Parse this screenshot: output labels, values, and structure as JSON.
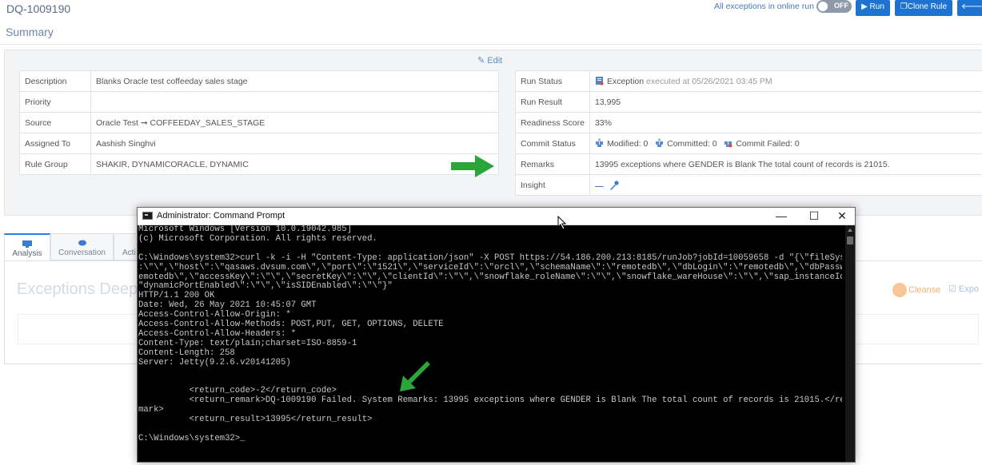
{
  "header": {
    "rule_id": "DQ-1009190",
    "exceptions_online_label": "All exceptions in online run",
    "toggle_label": "OFF",
    "run_label": "▶ Run",
    "clone_label": "❐Clone Rule",
    "ge_label": "🡐 Ge"
  },
  "summary": {
    "title": "Summary",
    "edit_label": "✎ Edit",
    "left_rows": [
      {
        "key": "Description",
        "value": "Blanks Oracle test coffeeday sales stage"
      },
      {
        "key": "Priority",
        "value": ""
      },
      {
        "key": "Source",
        "value": "Oracle Test ➞ COFFEEDAY_SALES_STAGE"
      },
      {
        "key": "Assigned To",
        "value": "Aashish Singhvi"
      },
      {
        "key": "Rule Group",
        "value": "SHAKIR, DYNAMICORACLE, DYNAMIC"
      }
    ],
    "right": {
      "run_status_key": "Run Status",
      "run_status_value": "Exception",
      "executed_at": "executed at 05/26/2021 03:45 PM",
      "run_result_key": "Run Result",
      "run_result_value": "13,995",
      "readiness_key": "Readiness Score",
      "readiness_value": "33%",
      "commit_key": "Commit Status",
      "modified": "Modified: 0",
      "committed": "Committed: 0",
      "commit_failed": "Commit Failed: 0",
      "remarks_key": "Remarks",
      "remarks_value": "13995 exceptions where GENDER is Blank The total count of records is 21015.",
      "insight_key": "Insight",
      "insight_value": "—"
    }
  },
  "tabs": {
    "analysis": "Analysis",
    "conversation": "Conversation",
    "activity": "Acti"
  },
  "content": {
    "exceptions_title": "Exceptions Deep",
    "cleanse_label": "Cleanse",
    "export_label": "Expo"
  },
  "cmd": {
    "title": "Administrator: Command Prompt",
    "min": "—",
    "max": "☐",
    "close": "✕",
    "text": "Microsoft Windows [Version 10.0.19042.985]\n(c) Microsoft Corporation. All rights reserved.\n\nC:\\Windows\\system32>curl -k -i -H \"Content-Type: application/json\" -X POST https://54.186.200.213:8185/runJob?jobId=10059658 -d \"{\\\"fileSystemPath\\\"\n:\\\"\\\",\\\"host\\\":\\\"qasaws.dvsum.com\\\",\\\"port\\\":\\\"1521\\\",\\\"serviceId\\\":\\\"orcl\\\",\\\"schemaName\\\":\\\"remotedb\\\",\\\"dbLogin\\\":\\\"remotedb\\\",\\\"dbPassword\\\":\\\"r\nemotedb\\\",\\\"accessKey\\\":\\\"\\\",\\\"secretKey\\\":\\\"\\\",\\\"clientId\\\":\\\"\\\",\\\"snowflake_roleName\\\":\\\"\\\",\\\"snowflake_wareHouse\\\":\\\"\\\",\\\"sap_instanceId\\\":\\\"\\\",\\\n\"dynamicPortEnabled\\\":\\\"\\\",\\\"isSIDEnabled\\\":\\\"\\\"}\"\nHTTP/1.1 200 OK\nDate: Wed, 26 May 2021 10:45:07 GMT\nAccess-Control-Allow-Origin: *\nAccess-Control-Allow-Methods: POST,PUT, GET, OPTIONS, DELETE\nAccess-Control-Allow-Headers: *\nContent-Type: text/plain;charset=ISO-8859-1\nContent-Length: 258\nServer: Jetty(9.2.6.v20141205)\n\n\n          <return_code>-2</return_code>\n          <return_remark>DQ-1009190 Failed. System Remarks: 13995 exceptions where GENDER is Blank The total count of records is 21015.</return_re\nmark>\n          <return_result>13995</return_result>\n\nC:\\Windows\\system32>_"
  },
  "colors": {
    "accent_blue": "#1e73d2",
    "arrow_green": "#2aa63a",
    "cmd_background": "#000000"
  }
}
